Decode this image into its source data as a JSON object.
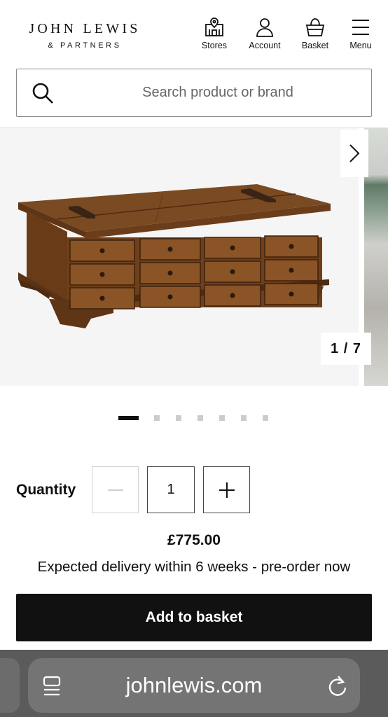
{
  "header": {
    "logo_main": "JOHN LEWIS",
    "logo_sub": "& PARTNERS",
    "nav": [
      {
        "label": "Stores",
        "icon": "stores-icon"
      },
      {
        "label": "Account",
        "icon": "account-icon"
      },
      {
        "label": "Basket",
        "icon": "basket-icon"
      },
      {
        "label": "Menu",
        "icon": "menu-icon"
      }
    ]
  },
  "search": {
    "placeholder": "Search product or brand",
    "value": ""
  },
  "gallery": {
    "counter": "1 / 7",
    "current_slide": 1,
    "total_slides": 7
  },
  "quantity": {
    "label": "Quantity",
    "value": "1"
  },
  "product": {
    "price": "£775.00",
    "delivery": "Expected delivery within 6 weeks - pre-order now",
    "add_button": "Add to basket"
  },
  "browser": {
    "url": "johnlewis.com"
  },
  "colors": {
    "primary": "#111111",
    "browser_bar": "#5b5b5b",
    "url_pill": "#747474"
  }
}
